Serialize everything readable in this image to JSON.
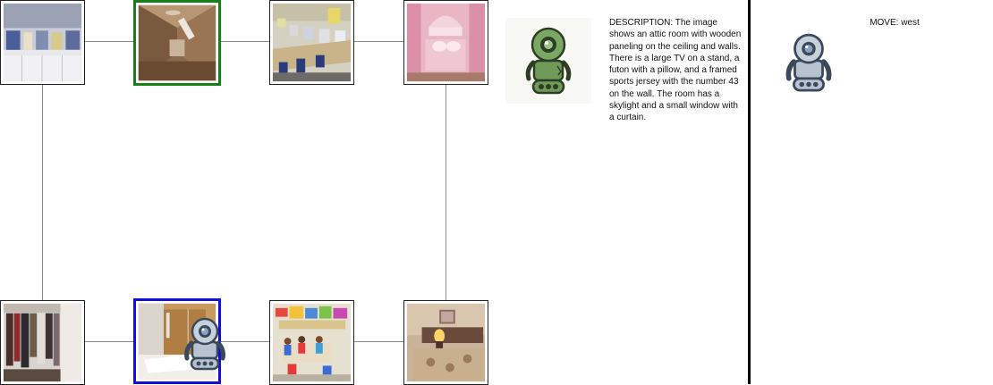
{
  "description": "DESCRIPTION: The image shows an attic room with wooden paneling on the ceiling and walls. There is a large TV on a stand, a futon with a pillow, and a framed sports jersey with the number 43 on the wall. The room has a skylight and a small window with a curtain.",
  "move": "MOVE: west",
  "colors": {
    "goal_border": "#158015",
    "current_border": "#1010d8",
    "edge": "#8a8a8a",
    "divider": "#000000"
  },
  "rooms": [
    {
      "name": "room-top-0",
      "scene": "kitchen-counter-photo",
      "status": "normal"
    },
    {
      "name": "room-top-1",
      "scene": "attic-room-photo",
      "status": "goal"
    },
    {
      "name": "room-top-2",
      "scene": "computer-lab-photo",
      "status": "normal"
    },
    {
      "name": "room-top-3",
      "scene": "pink-bedroom-photo",
      "status": "normal"
    },
    {
      "name": "room-bottom-0",
      "scene": "closet-photo",
      "status": "normal"
    },
    {
      "name": "room-bottom-1",
      "scene": "bathroom-shower-photo",
      "status": "current"
    },
    {
      "name": "room-bottom-2",
      "scene": "classroom-photo",
      "status": "normal"
    },
    {
      "name": "room-bottom-3",
      "scene": "hotel-bedroom-photo",
      "status": "normal"
    }
  ],
  "icons": {
    "observer": "green-robot-icon",
    "player": "gray-robot-icon"
  }
}
